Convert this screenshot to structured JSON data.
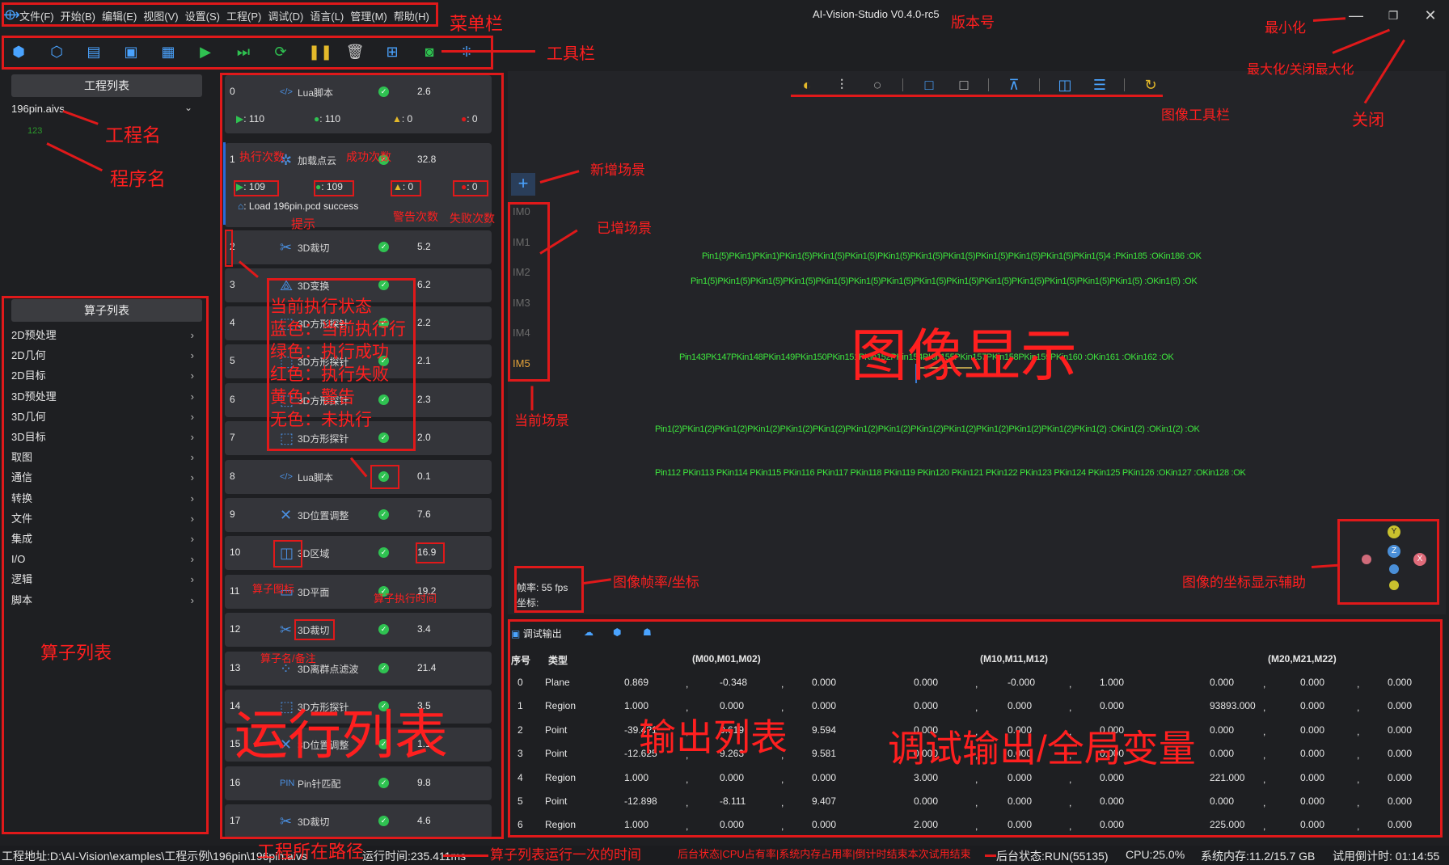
{
  "menubar": {
    "items": [
      "文件(F)",
      "开始(B)",
      "编辑(E)",
      "视图(V)",
      "设置(S)",
      "工程(P)",
      "调试(D)",
      "语言(L)",
      "管理(M)",
      "帮助(H)"
    ],
    "version": "AI-Vision-Studio V0.4.0-rc5"
  },
  "project": {
    "header": "工程列表",
    "name": "196pin.aivs",
    "program": "123"
  },
  "operators": {
    "header": "算子列表",
    "items": [
      "2D预处理",
      "2D几何",
      "2D目标",
      "3D预处理",
      "3D几何",
      "3D目标",
      "取图",
      "通信",
      "转换",
      "文件",
      "集成",
      "I/O",
      "逻辑",
      "脚本"
    ]
  },
  "runlist": {
    "rows": [
      {
        "idx": "0",
        "name": "Lua脚本",
        "time": "2.6"
      },
      {
        "idx": "1",
        "name": "加载点云",
        "time": "32.8"
      },
      {
        "idx": "2",
        "name": "3D裁切",
        "time": "5.2"
      },
      {
        "idx": "3",
        "name": "3D变换",
        "time": "6.2"
      },
      {
        "idx": "4",
        "name": "3D方形探针",
        "time": "2.2"
      },
      {
        "idx": "5",
        "name": "3D方形探针",
        "time": "2.1"
      },
      {
        "idx": "6",
        "name": "3D方形探针",
        "time": "2.3"
      },
      {
        "idx": "7",
        "name": "3D方形探针",
        "time": "2.0"
      },
      {
        "idx": "8",
        "name": "Lua脚本",
        "time": "0.1"
      },
      {
        "idx": "9",
        "name": "3D位置调整",
        "time": "7.6"
      },
      {
        "idx": "10",
        "name": "3D区域",
        "time": "16.9"
      },
      {
        "idx": "11",
        "name": "3D平面",
        "time": "19.2"
      },
      {
        "idx": "12",
        "name": "3D裁切",
        "time": "3.4"
      },
      {
        "idx": "13",
        "name": "3D离群点滤波",
        "time": "21.4"
      },
      {
        "idx": "14",
        "name": "3D方形探针",
        "time": "3.5"
      },
      {
        "idx": "15",
        "name": "3D位置调整",
        "time": "1.1"
      },
      {
        "idx": "16",
        "name": "Pin针匹配",
        "time": "9.8"
      },
      {
        "idx": "17",
        "name": "3D裁切",
        "time": "4.6"
      }
    ],
    "row0_stats": {
      "exec": ": 110",
      "ok": ": 110",
      "warn": ": 0",
      "fail": ": 0"
    },
    "row1_stats": {
      "exec": ": 109",
      "ok": ": 109",
      "warn": ": 0",
      "fail": ": 0"
    },
    "row1_hint": ": Load 196pin.pcd success"
  },
  "scenes": {
    "items": [
      "IM0",
      "IM1",
      "IM2",
      "IM3",
      "IM4",
      "IM5"
    ],
    "current": "IM5",
    "add": "+"
  },
  "image": {
    "fps": "帧率:  55 fps",
    "coord": "坐标:",
    "pin_lines": [
      "Pin1(5)PKin1)PKin1)PKin1(5)PKin1(5)PKin1(5)PKin1(5)PKin1(5)PKin1(5)PKin1(5)PKin1(5)PKin1(5)PKin1(5)4 :PKin185 :OKin186 :OK",
      "Pin1(5)PKin1(5)PKin1(5)PKin1(5)PKin1(5)PKin1(5)PKin1(5)PKin1(5)PKin1(5)PKin1(5)PKin1(5)PKin1(5)PKin1(5)PKin1(5) :OKin1(5) :OK",
      "Pin143PK147PKin148PKin149PKin150PKin151PKin152PKin154PKin155PKin157PKin158PKin159PKin160 :OKin161 :OKin162 :OK",
      "Pin1(2)PKin1(2)PKin1(2)PKin1(2)PKin1(2)PKin1(2)PKin1(2)PKin1(2)PKin1(2)PKin1(2)PKin1(2)PKin1(2)PKin1(2)PKin1(2) :OKin1(2) :OKin1(2) :OK",
      "Pin112 PKin113 PKin114 PKin115 PKin116 PKin117 PKin118 PKin119 PKin120 PKin121 PKin122 PKin123 PKin124 PKin125 PKin126 :OKin127 :OKin128 :OK"
    ],
    "axis": {
      "y": "Y",
      "z": "Z",
      "x": "X"
    }
  },
  "output": {
    "tab_label": "调试输出",
    "headers": {
      "idx": "序号",
      "type": "类型",
      "g1": "(M00,M01,M02)",
      "g2": "(M10,M11,M12)",
      "g3": "(M20,M21,M22)"
    },
    "rows": [
      {
        "idx": "0",
        "type": "Plane",
        "v": [
          "0.869",
          "-0.348",
          "0.000",
          "0.000",
          "-0.000",
          "1.000",
          "0.000",
          "0.000",
          "0.000"
        ]
      },
      {
        "idx": "1",
        "type": "Region",
        "v": [
          "1.000",
          "0.000",
          "0.000",
          "0.000",
          "0.000",
          "0.000",
          "93893.000",
          "0.000",
          "0.000"
        ]
      },
      {
        "idx": "2",
        "type": "Point",
        "v": [
          "-39.4?1",
          "0.619",
          "9.594",
          "0.000",
          "0.000",
          "0.000",
          "0.000",
          "0.000",
          "0.000"
        ]
      },
      {
        "idx": "3",
        "type": "Point",
        "v": [
          "-12.625",
          "9.263",
          "9.581",
          "0.000",
          "0.000",
          "0.000",
          "0.000",
          "0.000",
          "0.000"
        ]
      },
      {
        "idx": "4",
        "type": "Region",
        "v": [
          "1.000",
          "0.000",
          "0.000",
          "3.000",
          "0.000",
          "0.000",
          "221.000",
          "0.000",
          "0.000"
        ]
      },
      {
        "idx": "5",
        "type": "Point",
        "v": [
          "-12.898",
          "-8.111",
          "9.407",
          "0.000",
          "0.000",
          "0.000",
          "0.000",
          "0.000",
          "0.000"
        ]
      },
      {
        "idx": "6",
        "type": "Region",
        "v": [
          "1.000",
          "0.000",
          "0.000",
          "2.000",
          "0.000",
          "0.000",
          "225.000",
          "0.000",
          "0.000"
        ]
      }
    ]
  },
  "statusbar": {
    "path": "工程地址:D:\\AI-Vision\\examples\\工程示例\\196pin\\196pin.aivs",
    "runtime": "运行时间:235.411ms",
    "backend": "后台状态:RUN(55135)",
    "cpu": "CPU:25.0%",
    "mem": "系统内存:11.2/15.7 GB",
    "trial": "试用倒计时: 01:14:55"
  },
  "annotations": {
    "menubar": "菜单栏",
    "version": "版本号",
    "minimize": "最小化",
    "maximize": "最大化/关闭最大化",
    "close": "关闭",
    "toolbar": "工具栏",
    "project_name": "工程名",
    "program_name": "程序名",
    "image_toolbar": "图像工具栏",
    "new_scene": "新增场景",
    "added_scene": "已增场景",
    "current_scene": "当前场景",
    "image_display": "图像显示",
    "fps_coord": "图像帧率/坐标",
    "coord_helper": "图像的坐标显示辅助",
    "exec_count": "执行次数",
    "success_count": "成功次数",
    "hint": "提示",
    "warn_count": "警告次数",
    "fail_count": "失败次数",
    "status_lines": [
      "当前执行状态",
      "蓝色：当前执行行",
      "绿色：执行成功",
      "红色：执行失败",
      "黄色：警告",
      "无色：未执行"
    ],
    "op_icon": "算子图标",
    "op_time": "算子执行时间",
    "op_note": "算子名/备注",
    "run_list": "运行列表",
    "output_list": "输出列表",
    "debug_output": "调试输出/全局变量",
    "op_list": "算子列表",
    "project_path": "工程所在路径",
    "run_time": "算子列表运行一次的时间",
    "status_desc": "后台状态|CPU占有率|系统内存占用率|倒计时结束本次试用结束"
  },
  "colors": {
    "ok": "#2fc251",
    "accent": "#4aa3ff",
    "annotation": "#e0191a",
    "pin_text": "#3ee63e"
  }
}
